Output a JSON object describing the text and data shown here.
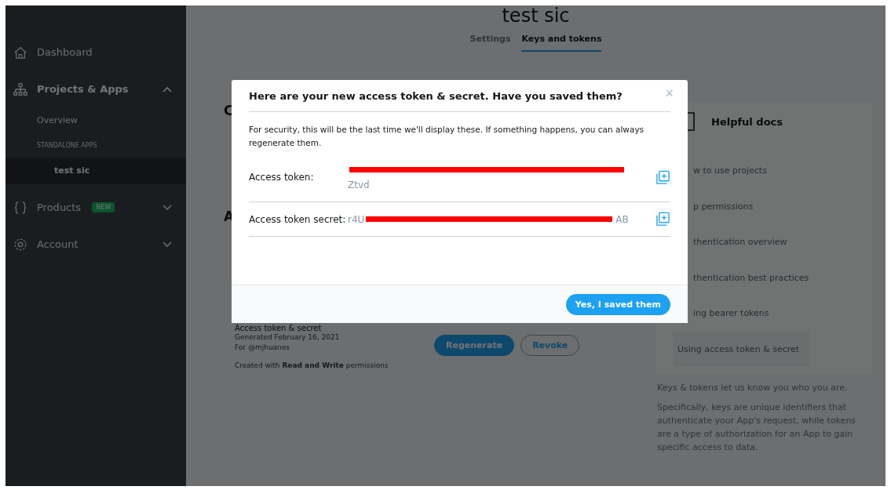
{
  "sidebar": {
    "items": [
      {
        "kind": "nav",
        "label": "Dashboard"
      },
      {
        "kind": "nav",
        "label": "Projects & Apps",
        "expanded": true
      },
      {
        "kind": "sub",
        "label": "Overview",
        "selected": false
      },
      {
        "kind": "section",
        "label": "STANDALONE APPS"
      },
      {
        "kind": "sub",
        "label": "test sic",
        "selected": true
      },
      {
        "kind": "nav",
        "label": "Products",
        "badge": "NEW",
        "expanded": false
      },
      {
        "kind": "nav",
        "label": "Account",
        "expanded": false
      }
    ]
  },
  "page": {
    "title": "test sic",
    "tabs": [
      {
        "label": "Settings",
        "selected": false
      },
      {
        "label": "Keys and tokens",
        "selected": true
      }
    ],
    "section_1_heading": "C",
    "section_2_heading": "A",
    "token_card": {
      "title": "Access token & secret",
      "generated": "Generated February 16, 2021",
      "owner": "For @mjhuanes",
      "permissions": "Created with **Read and Write** permissions",
      "buttons": [
        {
          "kind": "primary",
          "label": "Regenerate"
        },
        {
          "kind": "outline",
          "label": "Revoke"
        }
      ]
    },
    "docs": {
      "title": "Helpful docs",
      "items": [
        {
          "label": "w to use projects",
          "selected": false
        },
        {
          "label": "p permissions",
          "selected": false
        },
        {
          "label": "thentication overview",
          "selected": false
        },
        {
          "label": "thentication best practices",
          "selected": false
        },
        {
          "label": "ing bearer tokens",
          "selected": false
        },
        {
          "label": "Using access token & secret",
          "selected": true
        }
      ]
    },
    "notes": [
      "Keys & tokens let us know you who you are.",
      "Specifically, keys are unique identifiers that authenticate your App's request, while tokens are a type of authorization for an App to gain specific access to data."
    ]
  },
  "dialog": {
    "title": "Here are your new access token & secret. Have you saved them?",
    "close": "×",
    "description": "For security, this will be the last time we'll display these. If something happens, you can always regenerate them.",
    "fields": [
      {
        "label": "Access token:",
        "lines": [
          [
            {
              "kind": "redacted"
            }
          ],
          [
            {
              "kind": "text",
              "text": "Ztvd"
            }
          ]
        ]
      },
      {
        "label": "Access token secret:",
        "lines": [
          [
            {
              "kind": "text",
              "text": "r4U"
            },
            {
              "kind": "redacted"
            },
            {
              "kind": "text",
              "text": "AB"
            }
          ]
        ]
      }
    ],
    "confirm_button": "Yes, I saved them"
  }
}
